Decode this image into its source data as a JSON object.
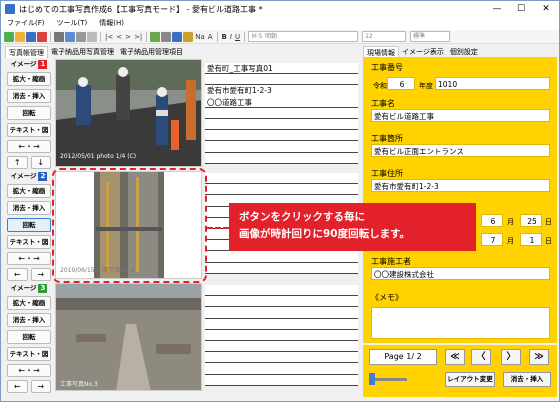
{
  "window": {
    "title": "はじめての工事写真作成6【工事写真モード】 - 愛有ビル道路工事 *",
    "controls": {
      "minimize": "—",
      "maximize": "☐",
      "close": "✕"
    }
  },
  "menu": [
    "ファイル(F)",
    "ツール(T)",
    "情報(H)"
  ],
  "toolbar": {
    "font_name": "ＭＳ 明朝",
    "font_size": "12",
    "style": "標準",
    "bold": "B",
    "italic": "I",
    "underline": "U",
    "label_na": "Na",
    "label_a": "A"
  },
  "left_tabs": [
    "写真帳管理",
    "電子納品用写真管理",
    "電子納品用管理項目"
  ],
  "right_tabs": [
    "現場情報",
    "イメージ表示",
    "個別設定"
  ],
  "image_groups": [
    {
      "label": "イメージ",
      "num": "1",
      "badge_color": "#e3212b",
      "buttons": [
        "拡大・縮画",
        "消去・挿入",
        "回転",
        "テキスト・図"
      ],
      "arrows": [
        "←・→",
        "↑",
        "↓"
      ]
    },
    {
      "label": "イメージ",
      "num": "2",
      "badge_color": "#2a62c4",
      "buttons": [
        "拡大・縮画",
        "消去・挿入",
        "回転",
        "テキスト・図"
      ],
      "arrows": [
        "←・→",
        "←",
        "→"
      ]
    },
    {
      "label": "イメージ",
      "num": "3",
      "badge_color": "#2f9a3a",
      "buttons": [
        "拡大・縮画",
        "消去・挿入",
        "回転",
        "テキスト・図"
      ],
      "arrows": [
        "←・→",
        "←",
        "→"
      ]
    }
  ],
  "photo_captions": [
    "2012/05/01\nphoto 1/4 (C)",
    "2010/06/15\n工事写真No.4",
    "工事写真No.3"
  ],
  "memo_lines": [
    "愛有町_工事写真01",
    "",
    "愛有市愛有町1-2-3",
    "〇〇道路工事"
  ],
  "site_info": {
    "koji_bango_label": "工事番号",
    "reiwa_label": "令和",
    "reiwa_value": "6",
    "nendo_label": "年度",
    "koji_bango_value": "1010",
    "koji_mei_label": "工事名",
    "koji_mei_value": "愛有ビル道路工事",
    "koji_kasho_label": "工事箇所",
    "koji_kasho_value": "愛有ビル正面エントランス",
    "koji_jusho_label": "工事住所",
    "koji_jusho_value": "愛有市愛有町1-2-3",
    "date1_month": "6",
    "date1_day": "25",
    "date2_month": "7",
    "date2_day": "1",
    "month_label": "月",
    "day_label": "日",
    "sekosha_label": "工事施工者",
    "sekosha_value": "〇〇建設株式会社",
    "memo_label": "《メモ》"
  },
  "pager": {
    "page": "Page 1/ 2",
    "first": "≪",
    "prev": "〈",
    "next": "〉",
    "last": "≫",
    "layout_btn": "レイアウト変更",
    "delete_btn": "消去・挿入"
  },
  "callout": {
    "line1": "ボタンをクリックする毎に",
    "line2": "画像が時計回りに90度回転します。"
  }
}
